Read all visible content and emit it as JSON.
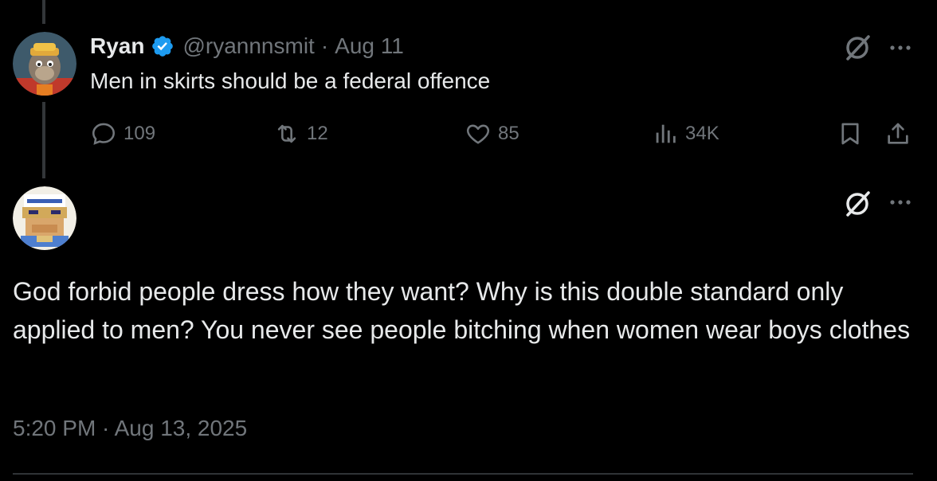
{
  "parent_tweet": {
    "display_name": "Ryan",
    "handle": "@ryannnsmit",
    "separator": "·",
    "date": "Aug 11",
    "text": "Men in skirts should be a federal offence",
    "reply_count": "109",
    "retweet_count": "12",
    "like_count": "85",
    "view_count": "34K"
  },
  "reply_tweet": {
    "text": "God forbid people dress how they want? Why is this double standard only applied to men? You never see people bitching when women wear boys clothes",
    "timestamp": "5:20 PM · Aug 13, 2025"
  },
  "colors": {
    "background": "#000000",
    "text_primary": "#e7e9ea",
    "text_secondary": "#71767b",
    "verified_blue": "#1d9bf0",
    "thread_line": "#333639"
  },
  "icons": {
    "reply": "speech-bubble-icon",
    "retweet": "retweet-icon",
    "like": "heart-icon",
    "views": "bar-chart-icon",
    "bookmark": "bookmark-icon",
    "share": "share-icon",
    "grok": "grok-icon",
    "more": "more-dots-icon",
    "verified": "verified-badge-icon"
  }
}
